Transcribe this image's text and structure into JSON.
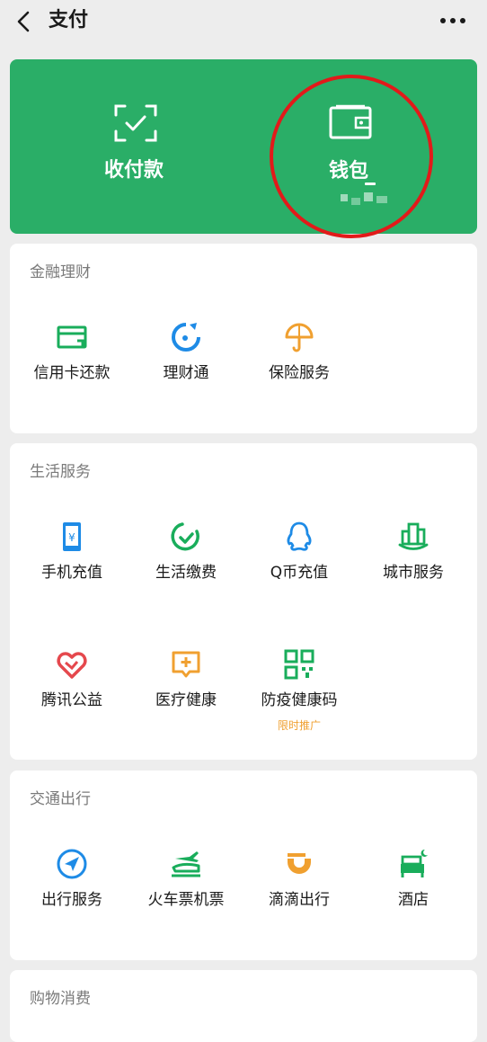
{
  "header": {
    "title": "支付"
  },
  "hero": {
    "pay_label": "收付款",
    "wallet_label": "钱包"
  },
  "sections": {
    "finance": {
      "title": "金融理财",
      "items": [
        {
          "label": "信用卡还款",
          "icon": "credit-card-icon"
        },
        {
          "label": "理财通",
          "icon": "wealth-icon"
        },
        {
          "label": "保险服务",
          "icon": "umbrella-icon"
        }
      ]
    },
    "life": {
      "title": "生活服务",
      "items": [
        {
          "label": "手机充值",
          "icon": "phone-topup-icon"
        },
        {
          "label": "生活缴费",
          "icon": "utility-bill-icon"
        },
        {
          "label": "Q币充值",
          "icon": "qq-penguin-icon"
        },
        {
          "label": "城市服务",
          "icon": "city-icon"
        },
        {
          "label": "腾讯公益",
          "icon": "charity-heart-icon"
        },
        {
          "label": "医疗健康",
          "icon": "medical-icon"
        },
        {
          "label": "防疫健康码",
          "icon": "health-qr-icon",
          "tag": "限时推广"
        }
      ]
    },
    "travel": {
      "title": "交通出行",
      "items": [
        {
          "label": "出行服务",
          "icon": "navigation-icon"
        },
        {
          "label": "火车票机票",
          "icon": "train-plane-icon"
        },
        {
          "label": "滴滴出行",
          "icon": "didi-icon"
        },
        {
          "label": "酒店",
          "icon": "hotel-bed-icon"
        }
      ]
    },
    "shopping": {
      "title": "购物消费"
    }
  },
  "colors": {
    "brand_green": "#2aae67",
    "icon_green": "#19ad5b",
    "icon_blue": "#1e8be6",
    "icon_orange": "#f0a030",
    "icon_red": "#e5484d",
    "highlight_red": "#e21a1a",
    "background": "#ededed"
  }
}
